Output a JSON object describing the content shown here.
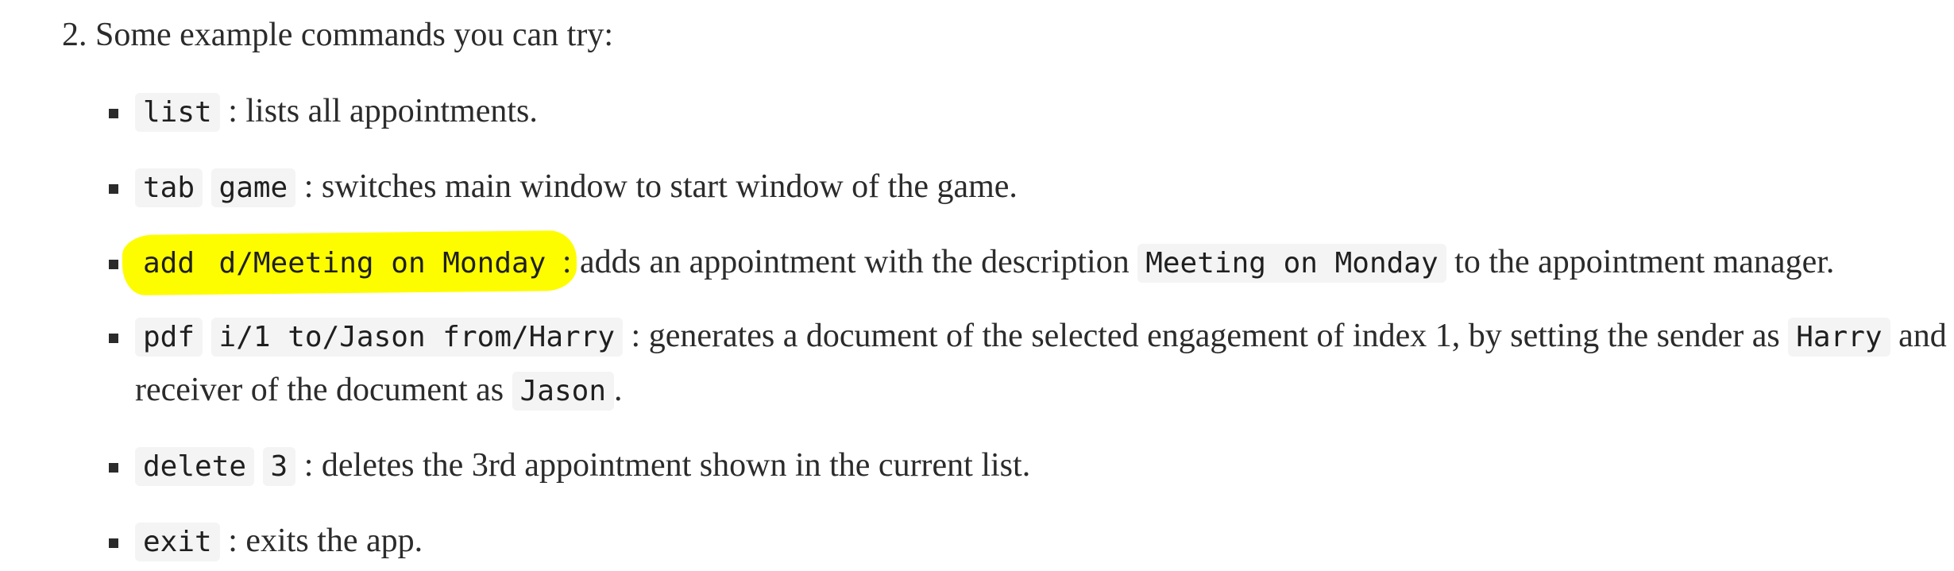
{
  "heading": "2. Some example commands you can try:",
  "highlight_color": "#fdfd00",
  "items": [
    {
      "codes": [
        "list"
      ],
      "desc": ": lists all appointments."
    },
    {
      "codes": [
        "tab",
        "game"
      ],
      "desc": ": switches main window to start window of the game."
    },
    {
      "codes": [
        "add",
        "d/Meeting on Monday"
      ],
      "desc_before": ": adds an appointment with the description",
      "inline_code": "Meeting on Monday",
      "desc_after": "to the appointment manager."
    },
    {
      "codes": [
        "pdf",
        "i/1 to/Jason from/Harry"
      ],
      "desc_before": ": generates a document of the selected engagement of index 1, by setting the sender as",
      "inline_code": "Harry",
      "desc_after": "and",
      "line2_before": "receiver of the document as",
      "line2_code": "Jason",
      "line2_after": "."
    },
    {
      "codes": [
        "delete",
        "3"
      ],
      "desc": ": deletes the 3rd appointment shown in the current list."
    },
    {
      "codes": [
        "exit"
      ],
      "desc": ": exits the app."
    }
  ]
}
